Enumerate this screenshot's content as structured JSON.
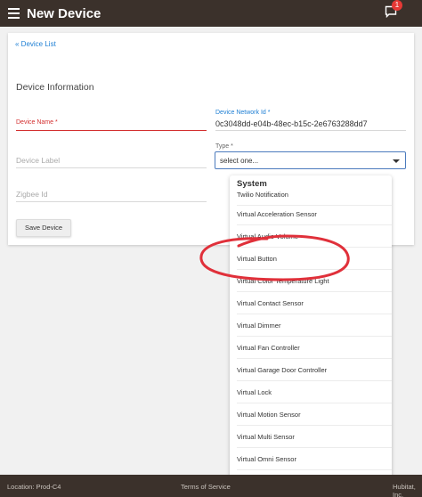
{
  "header": {
    "title": "New Device",
    "notification_count": "1",
    "menu_icon": "hamburger-menu-icon",
    "notification_icon": "chat-notification-icon"
  },
  "breadcrumb": {
    "back_link": "« Device List"
  },
  "form": {
    "section_title": "Device Information",
    "device_name": {
      "label": "Device Name *",
      "value": ""
    },
    "device_network_id": {
      "label": "Device Network Id *",
      "value": "0c3048dd-e04b-48ec-b15c-2e6763288dd7"
    },
    "device_label": {
      "placeholder": "Device Label"
    },
    "type": {
      "label": "Type *",
      "selected": "select one..."
    },
    "zigbee_id": {
      "placeholder": "Zigbee Id"
    },
    "save_label": "Save Device"
  },
  "type_dropdown": {
    "group_label": "System",
    "items": [
      "Twilio Notification",
      "Virtual Acceleration Sensor",
      "Virtual Audio Volume",
      "Virtual Button",
      "Virtual Color Temperature Light",
      "Virtual Contact Sensor",
      "Virtual Dimmer",
      "Virtual Fan Controller",
      "Virtual Garage Door Controller",
      "Virtual Lock",
      "Virtual Motion Sensor",
      "Virtual Multi Sensor",
      "Virtual Omni Sensor",
      "Virtual Presence"
    ]
  },
  "footer": {
    "location": "Location: Prod-C4",
    "terms": "Terms of Service",
    "copyright": "Hubitat, Inc."
  },
  "colors": {
    "header_bg": "#3b312b",
    "link": "#1e7fd4",
    "required_error": "#d32f2f",
    "annotation": "#e0303a"
  }
}
